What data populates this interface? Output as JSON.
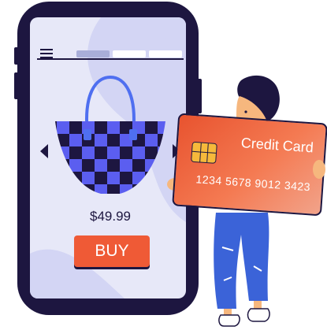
{
  "product": {
    "price": "$49.99",
    "buy_label": "BUY"
  },
  "card": {
    "title": "Credit Card",
    "number": "1234 5678 9012 3423"
  },
  "colors": {
    "phone_body": "#1d1640",
    "screen_bg": "#e7e8f8",
    "accent_orange": "#ef5a36",
    "bag_checker": "#5b5ef0",
    "bag_handle": "#4f6ff0",
    "jeans": "#3b63d8"
  },
  "icons": [
    "hamburger-icon",
    "left-arrow-icon",
    "right-arrow-icon",
    "shopping-bag-icon",
    "card-chip-icon"
  ]
}
